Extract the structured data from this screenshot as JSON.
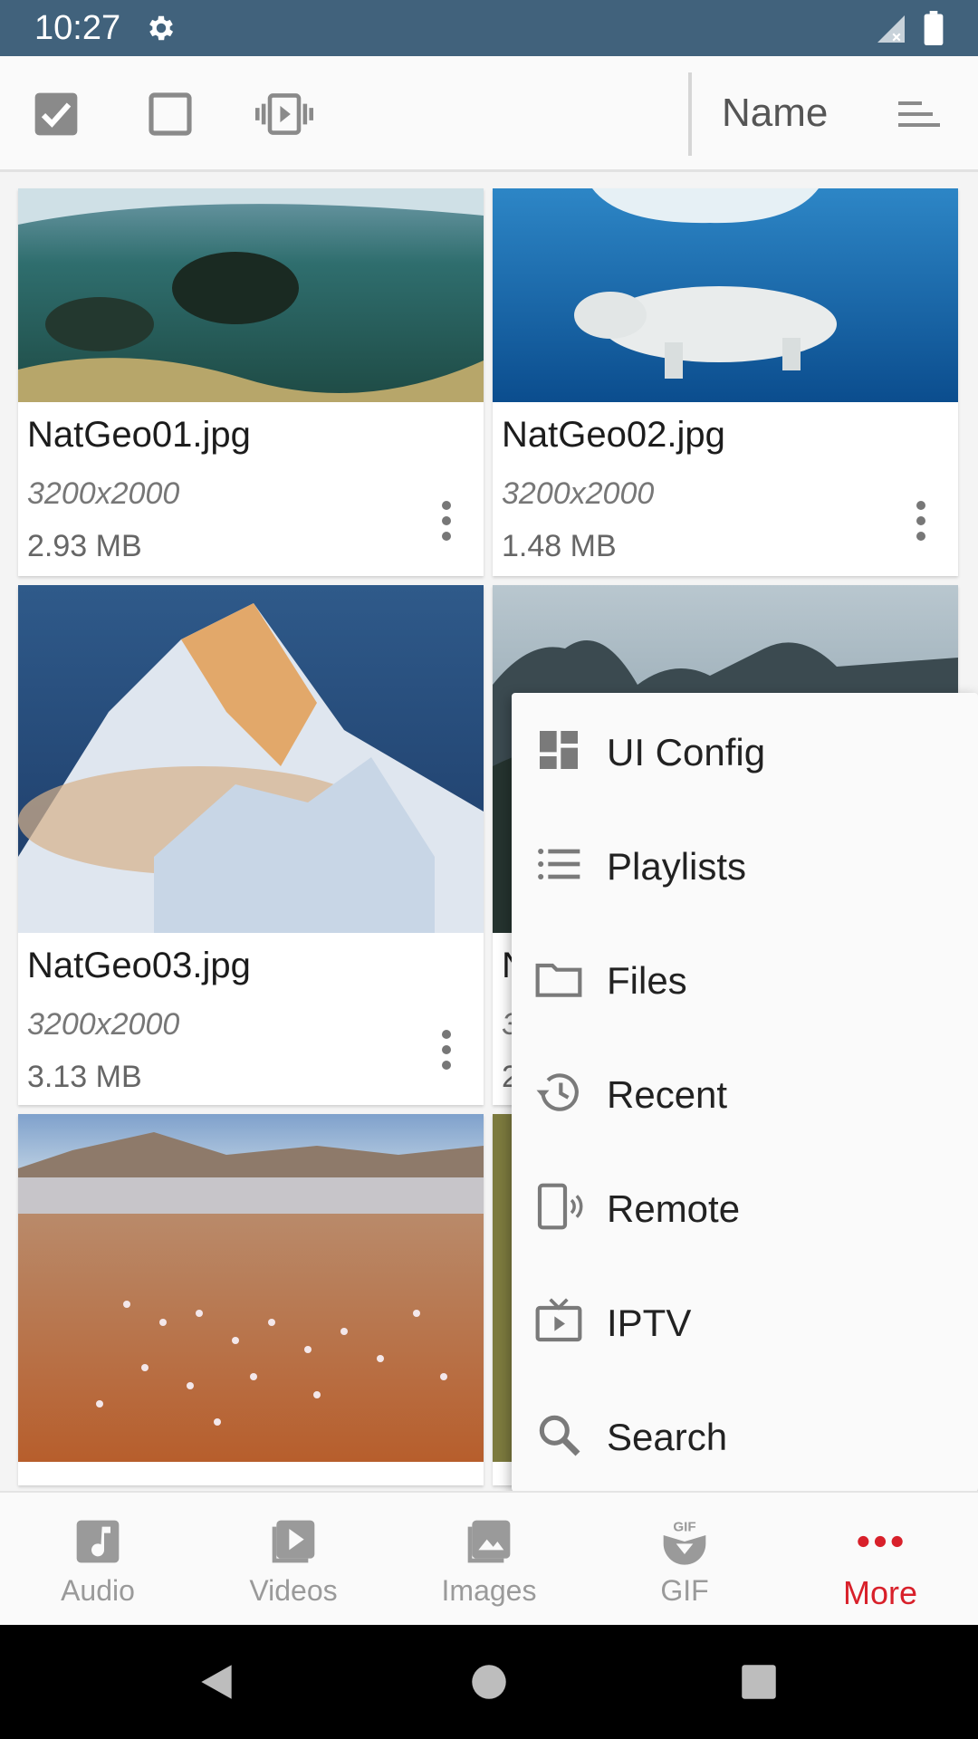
{
  "status_bar": {
    "time": "10:27",
    "icons": [
      "settings-gear-icon",
      "signal-no-data-icon",
      "battery-full-icon"
    ],
    "background": "#41627c"
  },
  "toolbar": {
    "icons": [
      "select-all-checkbox-icon",
      "deselect-checkbox-icon",
      "vibrate-play-icon"
    ],
    "sort_label": "Name",
    "sort_icon": "sort-lines-icon"
  },
  "grid": {
    "items": [
      {
        "name": "NatGeo01.jpg",
        "dims": "3200x2000",
        "size": "2.93 MB"
      },
      {
        "name": "NatGeo02.jpg",
        "dims": "3200x2000",
        "size": "1.48 MB"
      },
      {
        "name": "NatGeo03.jpg",
        "dims": "3200x2000",
        "size": "3.13 MB"
      },
      {
        "name": "N",
        "dims": "3",
        "size": "2"
      },
      {
        "name": "",
        "dims": "",
        "size": ""
      },
      {
        "name": "",
        "dims": "",
        "size": ""
      }
    ]
  },
  "menu": {
    "items": [
      {
        "label": "UI Config",
        "icon": "dashboard-icon"
      },
      {
        "label": "Playlists",
        "icon": "list-icon"
      },
      {
        "label": "Files",
        "icon": "folder-icon"
      },
      {
        "label": "Recent",
        "icon": "history-icon"
      },
      {
        "label": "Remote",
        "icon": "remote-device-icon"
      },
      {
        "label": "IPTV",
        "icon": "tv-icon"
      },
      {
        "label": "Search",
        "icon": "search-icon"
      }
    ]
  },
  "bottom_nav": {
    "items": [
      {
        "label": "Audio",
        "icon": "audio-icon"
      },
      {
        "label": "Videos",
        "icon": "video-icon"
      },
      {
        "label": "Images",
        "icon": "image-icon"
      },
      {
        "label": "GIF",
        "icon": "gif-icon"
      },
      {
        "label": "More",
        "icon": "more-dots-icon"
      }
    ],
    "active": "More",
    "active_color": "#d8202a",
    "inactive_color": "#9a9a9a"
  },
  "system_nav": [
    "back-icon",
    "home-icon",
    "recents-icon"
  ]
}
